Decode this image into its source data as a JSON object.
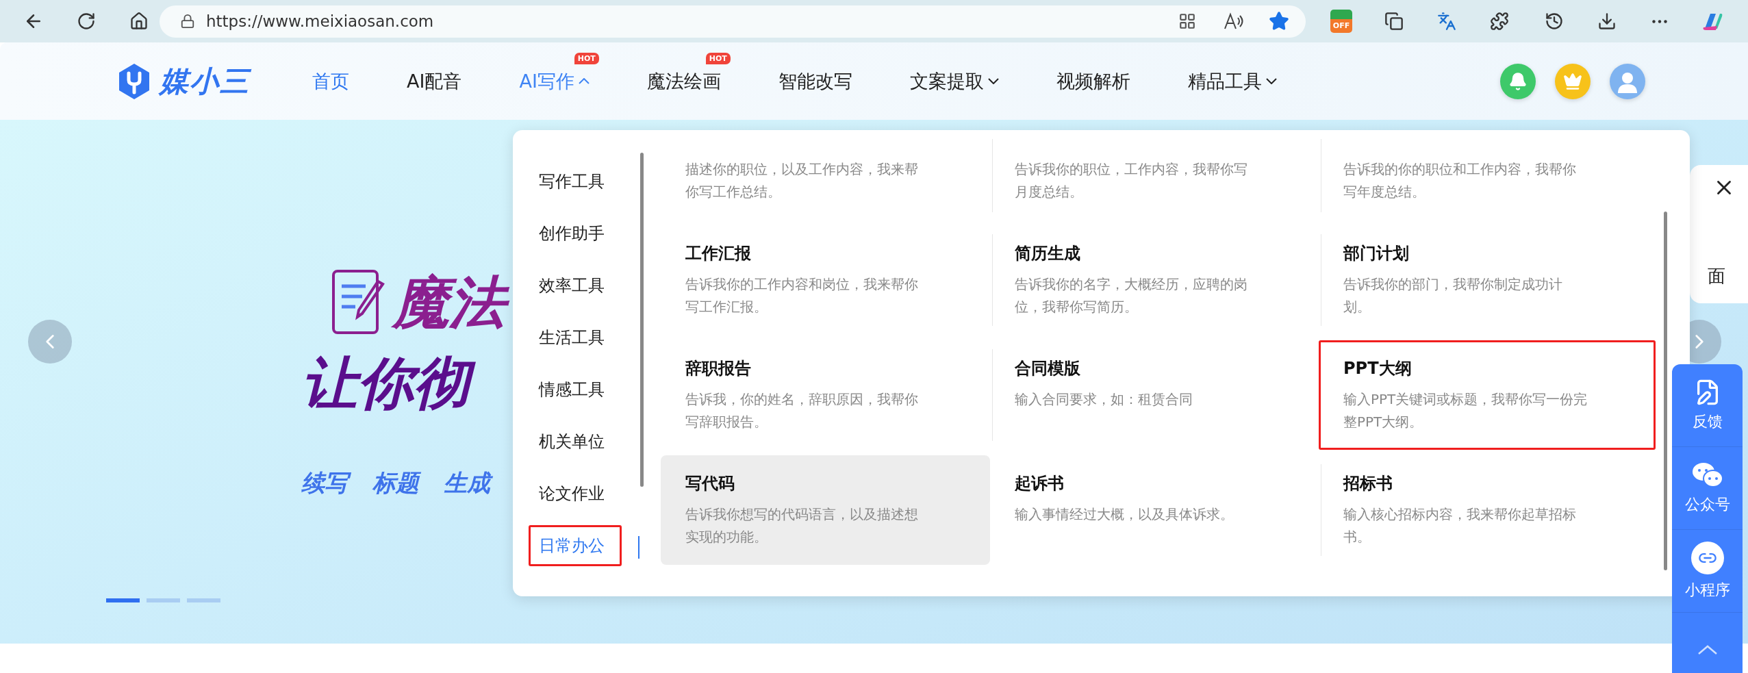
{
  "browser": {
    "url": "https://www.meixiaosan.com",
    "extension_badge": "OFF"
  },
  "header": {
    "logo_text": "媒小三",
    "nav": [
      {
        "label": "首页",
        "selected": true
      },
      {
        "label": "AI配音",
        "selected": false
      },
      {
        "label": "AI写作",
        "selected": false,
        "expanded": true,
        "badge": "HOT"
      },
      {
        "label": "魔法绘画",
        "selected": false,
        "badge": "HOT"
      },
      {
        "label": "智能改写",
        "selected": false
      },
      {
        "label": "文案提取",
        "selected": false,
        "expanded": false
      },
      {
        "label": "视频解析",
        "selected": false
      },
      {
        "label": "精品工具",
        "selected": false,
        "expanded": false
      }
    ]
  },
  "hero": {
    "headline_1": "魔法",
    "headline_2": "让你彻",
    "tags": [
      "续写",
      "标题",
      "生成"
    ],
    "slides": [
      {
        "selected": true
      },
      {
        "selected": false
      },
      {
        "selected": false
      }
    ]
  },
  "dropdown": {
    "categories": [
      {
        "label": "写作工具",
        "selected": false
      },
      {
        "label": "创作助手",
        "selected": false
      },
      {
        "label": "效率工具",
        "selected": false
      },
      {
        "label": "生活工具",
        "selected": false
      },
      {
        "label": "情感工具",
        "selected": false
      },
      {
        "label": "机关单位",
        "selected": false
      },
      {
        "label": "论文作业",
        "selected": false
      },
      {
        "label": "日常办公",
        "selected": true,
        "highlighted": true
      }
    ],
    "cards": [
      {
        "description": "描述你的职位，以及工作内容，我来帮你写工作总结。",
        "hovered": false,
        "highlighted": false
      },
      {
        "description": "告诉我你的职位，工作内容，我帮你写月度总结。",
        "hovered": false,
        "highlighted": false
      },
      {
        "description": "告诉我的你的职位和工作内容，我帮你写年度总结。",
        "hovered": false,
        "highlighted": false
      },
      {
        "title": "工作汇报",
        "description": "告诉我你的工作内容和岗位，我来帮你写工作汇报。",
        "hovered": false,
        "highlighted": false
      },
      {
        "title": "简历生成",
        "description": "告诉我你的名字，大概经历，应聘的岗位，我帮你写简历。",
        "hovered": false,
        "highlighted": false
      },
      {
        "title": "部门计划",
        "description": "告诉我你的部门，我帮你制定成功计划。",
        "hovered": false,
        "highlighted": false
      },
      {
        "title": "辞职报告",
        "description": "告诉我，你的姓名，辞职原因，我帮你写辞职报告。",
        "hovered": false,
        "highlighted": false
      },
      {
        "title": "合同模版",
        "description": "输入合同要求，如：租赁合同",
        "hovered": false,
        "highlighted": false
      },
      {
        "title": "PPT大纲",
        "description": "输入PPT关键词或标题，我帮你写一份完整PPT大纲。",
        "hovered": false,
        "highlighted": true
      },
      {
        "title": "写代码",
        "description": "告诉我你想写的代码语言，以及描述想实现的功能。",
        "hovered": true,
        "highlighted": false
      },
      {
        "title": "起诉书",
        "description": "输入事情经过大概，以及具体诉求。",
        "hovered": false,
        "highlighted": false
      },
      {
        "title": "招标书",
        "description": "输入核心招标内容，我来帮你起草招标书。",
        "hovered": false,
        "highlighted": false
      }
    ]
  },
  "side_card": {
    "text": "面"
  },
  "side_panel": {
    "items": [
      {
        "label": "反馈",
        "kind": "feedback"
      },
      {
        "label": "公众号",
        "kind": "wechat"
      },
      {
        "label": "小程序",
        "kind": "miniprogram"
      }
    ]
  }
}
